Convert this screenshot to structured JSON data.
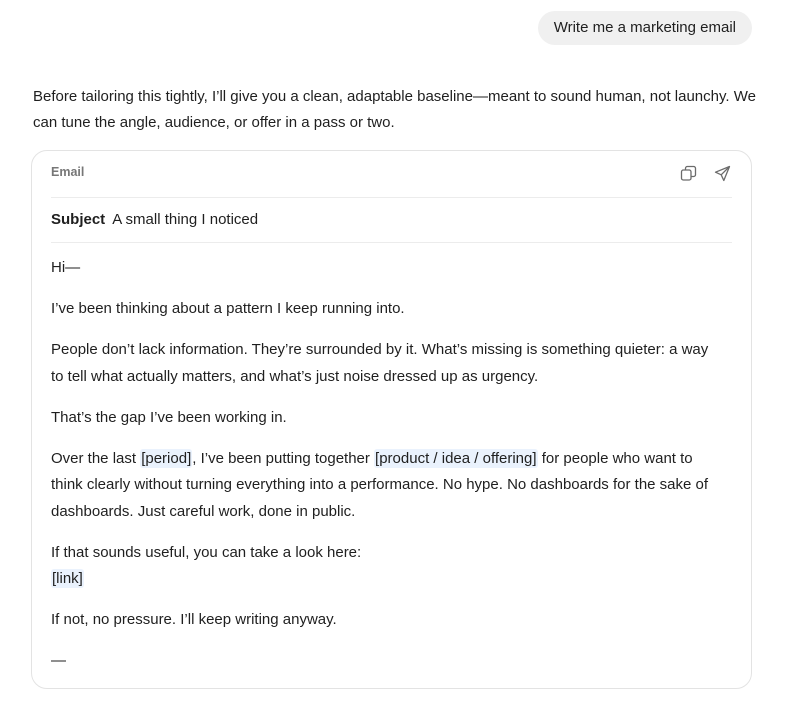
{
  "user_message": "Write me a marketing email",
  "assistant_intro": "Before tailoring this tightly, I’ll give you a clean, adaptable baseline—meant to sound human, not launchy. We can tune the angle, audience, or offer in a pass or two.",
  "email": {
    "label": "Email",
    "actions": {
      "copy_icon": "copy-icon",
      "send_icon": "send-icon"
    },
    "subject_key": "Subject",
    "subject_value": "A small thing I noticed",
    "greeting": "Hi—",
    "p1": "I’ve been thinking about a pattern I keep running into.",
    "p2": "People don’t lack information. They’re surrounded by it. What’s missing is something quieter: a way to tell what actually matters, and what’s just noise dressed up as urgency.",
    "p3": "That’s the gap I’ve been working in.",
    "p4": {
      "part1": "Over the last ",
      "placeholder1": "[period]",
      "part2": ", I’ve been putting together ",
      "placeholder2": "[product / idea / offering]",
      "part3": " for people who want to think clearly without turning everything into a performance. No hype. No dashboards for the sake of dashboards. Just careful work, done in public."
    },
    "p5": {
      "text": "If that sounds useful, you can take a look here:",
      "link": "[link]"
    },
    "p6": "If not, no pressure. I’ll keep writing anyway.",
    "signoff": "—"
  }
}
